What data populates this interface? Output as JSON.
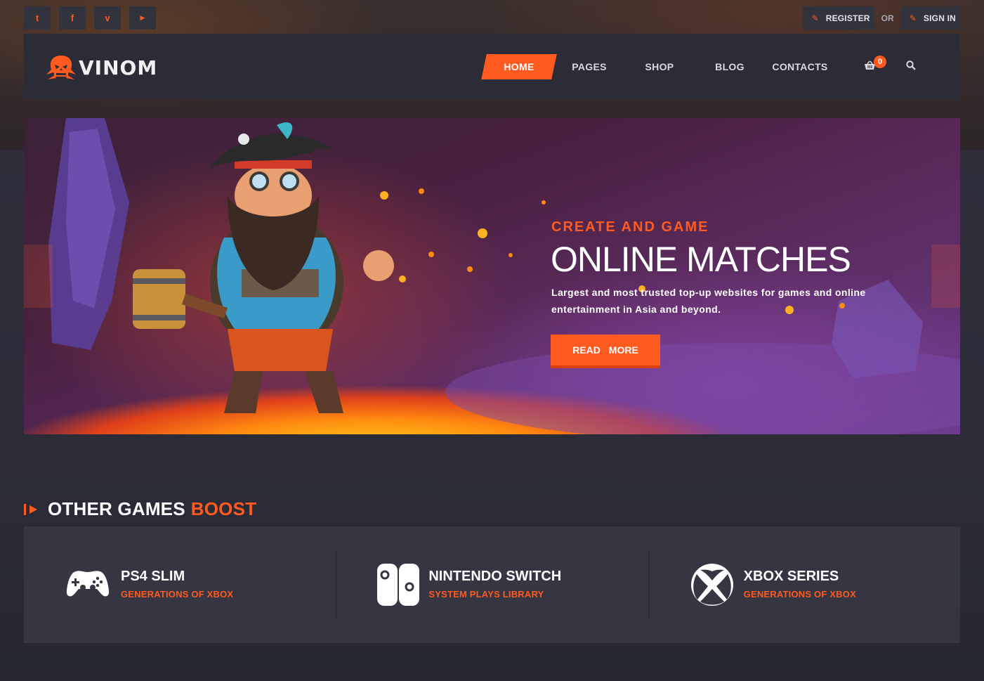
{
  "social": [
    {
      "name": "twitter-icon",
      "glyph": "t"
    },
    {
      "name": "facebook-icon",
      "glyph": "f"
    },
    {
      "name": "vimeo-icon",
      "glyph": "v"
    },
    {
      "name": "youtube-icon",
      "glyph": "▶"
    }
  ],
  "auth": {
    "register_label": "REGISTER",
    "or_label": "OR",
    "signin_label": "SIGN IN"
  },
  "brand": {
    "name": "VINOM"
  },
  "nav": {
    "home": "HOME",
    "pages": "PAGES",
    "shop": "SHOP",
    "blog": "BLOG",
    "contacts": "CONTACTS"
  },
  "cart": {
    "count": "0"
  },
  "hero": {
    "subtitle": "CREATE AND GAME",
    "title": "ONLINE MATCHES",
    "description": "Largest and most trusted top-up websites for games and online entertainment in Asia and beyond.",
    "button_label": "READ  MORE"
  },
  "section": {
    "title_main": "OTHER GAMES",
    "title_accent": "BOOST"
  },
  "platforms": [
    {
      "name": "PS4 SLIM",
      "subtitle": "GENERATIONS OF XBOX",
      "icon": "gamepad-icon"
    },
    {
      "name": "NINTENDO SWITCH",
      "subtitle": "SYSTEM PLAYS LIBRARY",
      "icon": "nintendo-switch-icon"
    },
    {
      "name": "XBOX SERIES",
      "subtitle": "GENERATIONS OF XBOX",
      "icon": "xbox-icon"
    }
  ],
  "colors": {
    "accent": "#ff5a1f",
    "panel": "#2b2c36",
    "background": "#2a2a36"
  }
}
